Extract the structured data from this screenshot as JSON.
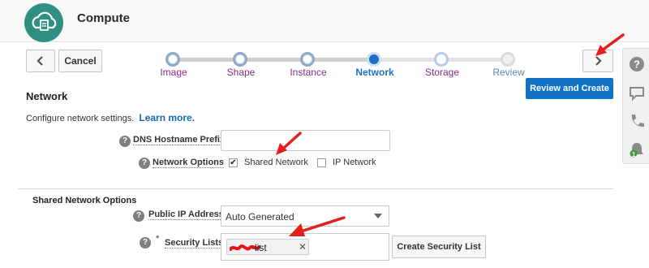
{
  "header": {
    "title": "Compute",
    "logo_icon": "cloud-compute-icon"
  },
  "toolbar": {
    "back_icon": "chevron-left-icon",
    "cancel_label": "Cancel",
    "next_icon": "chevron-right-icon"
  },
  "wizard": {
    "steps": [
      {
        "label": "Image",
        "state": "done"
      },
      {
        "label": "Shape",
        "state": "done"
      },
      {
        "label": "Instance",
        "state": "done"
      },
      {
        "label": "Network",
        "state": "current"
      },
      {
        "label": "Storage",
        "state": "future"
      },
      {
        "label": "Review",
        "state": "disabled"
      }
    ],
    "review_create_label": "Review and Create"
  },
  "network": {
    "title": "Network",
    "description": "Configure network settings.",
    "learn_more": "Learn more.",
    "dns_label": "DNS Hostname Prefix",
    "dns_value": "",
    "options_label": "Network Options",
    "option_shared": "Shared Network",
    "option_shared_checked": true,
    "option_ip": "IP Network",
    "option_ip_checked": false,
    "help_glyph": "?"
  },
  "shared_options": {
    "title": "Shared Network Options",
    "public_ip_label": "Public IP Address",
    "public_ip_value": "Auto Generated",
    "required_marker": "*",
    "security_lists_label": "Security Lists",
    "security_list_chip": "-list",
    "chip_close": "✕",
    "create_button": "Create Security List"
  },
  "side_rail": {
    "icons": [
      "help-icon",
      "chat-icon",
      "phone-icon",
      "notifications-bell-icon"
    ],
    "badge_count": "1"
  },
  "colors": {
    "brand": "#2f8f83",
    "primary": "#1272c6",
    "step_label": "#8a2a8a",
    "annotation_arrow": "#e41d1d"
  }
}
